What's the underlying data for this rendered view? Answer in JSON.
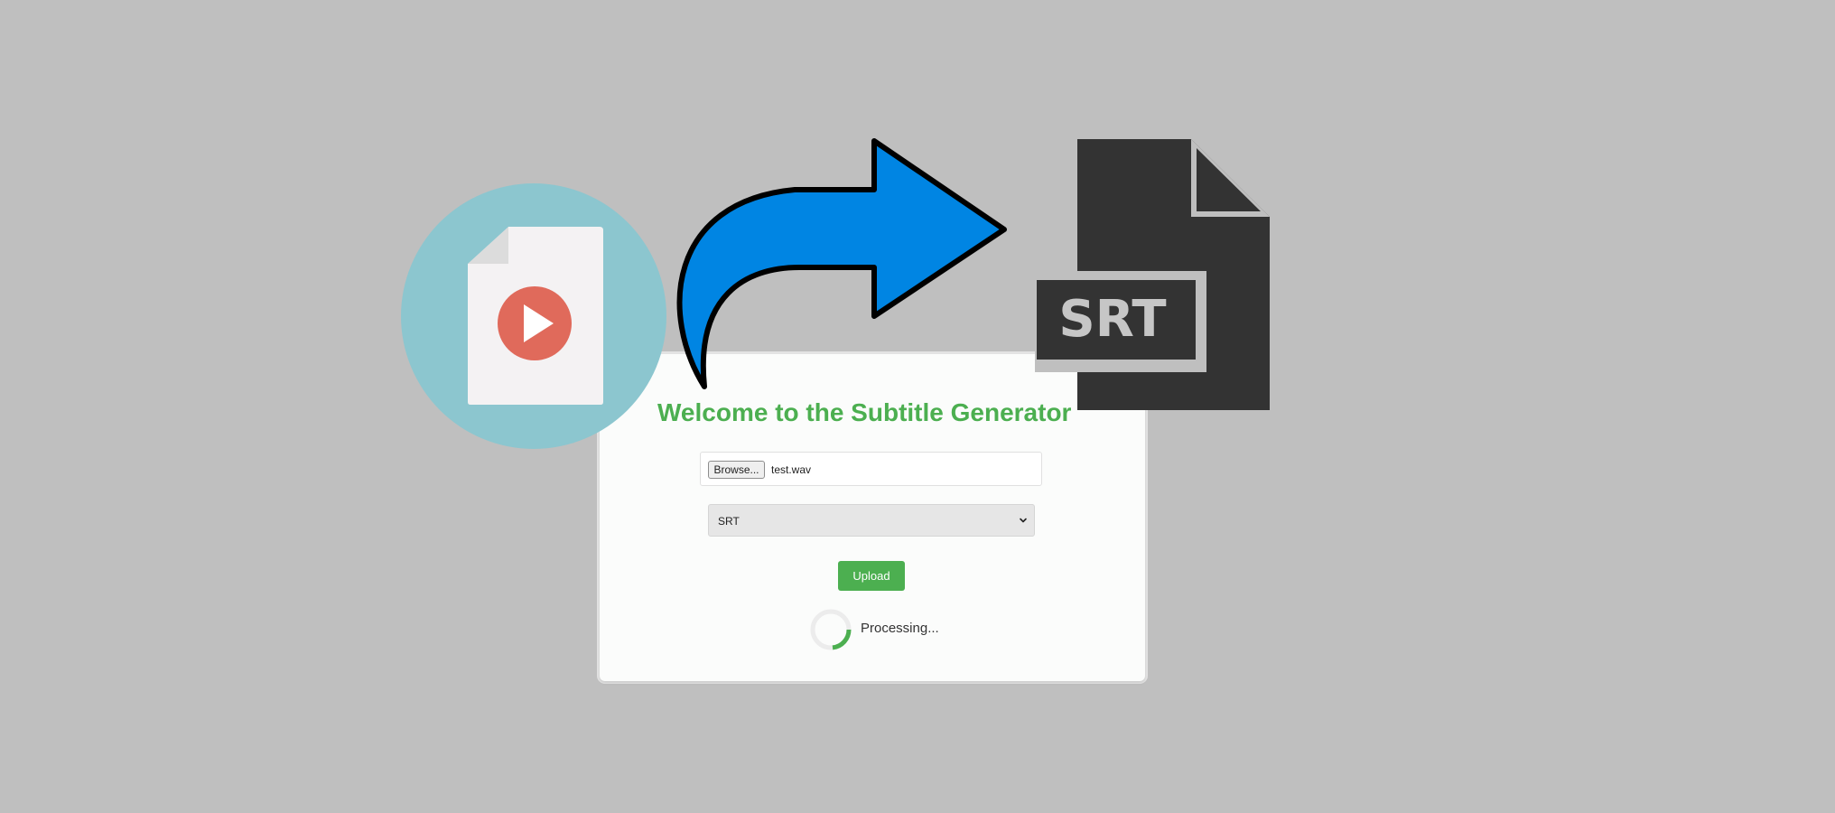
{
  "page": {
    "title": "Welcome to the Subtitle Generator"
  },
  "form": {
    "browse_label": "Browse...",
    "file_name": "test.wav",
    "format_value": "SRT",
    "upload_label": "Upload",
    "status_text": "Processing..."
  },
  "graphics": {
    "source_icon": "video-file-icon",
    "arrow_icon": "curved-arrow-icon",
    "target_icon": "srt-file-icon",
    "target_label": "SRT"
  },
  "colors": {
    "background": "#bfbfbf",
    "accent_green": "#4caf50",
    "arrow_blue": "#0085e3",
    "video_circle": "#8cc6cf",
    "play_red": "#e06a5b",
    "srt_dark": "#333333"
  }
}
